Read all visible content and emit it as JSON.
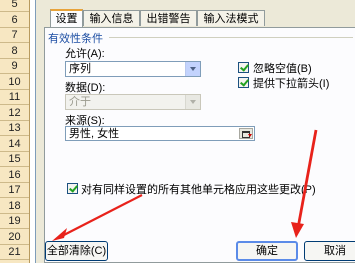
{
  "sheet": {
    "row_numbers": [
      "5",
      "6",
      "7",
      "8",
      "9",
      "10",
      "11",
      "12",
      "13",
      "14",
      "15",
      "16",
      "17",
      "18",
      "19",
      "20",
      "21"
    ]
  },
  "dialog": {
    "tabs": [
      {
        "label": "设置",
        "active": true
      },
      {
        "label": "输入信息",
        "active": false
      },
      {
        "label": "出错警告",
        "active": false
      },
      {
        "label": "输入法模式",
        "active": false
      }
    ],
    "group_label": "有效性条件",
    "allow": {
      "label": "允许(A):",
      "value": "序列"
    },
    "data": {
      "label": "数据(D):",
      "value": "介于",
      "disabled": true
    },
    "ignore_blank": {
      "label": "忽略空值(B)",
      "checked": true
    },
    "in_cell_dropdown": {
      "label": "提供下拉箭头(I)",
      "checked": true
    },
    "source": {
      "label": "来源(S):",
      "value": "男性, 女性"
    },
    "apply_all": {
      "label": "对有同样设置的所有其他单元格应用这些更改(P)",
      "checked": true
    },
    "buttons": {
      "clear_all": "全部清除(C)",
      "ok": "确定",
      "cancel": "取消"
    }
  },
  "annotation_color": "#e8221b"
}
